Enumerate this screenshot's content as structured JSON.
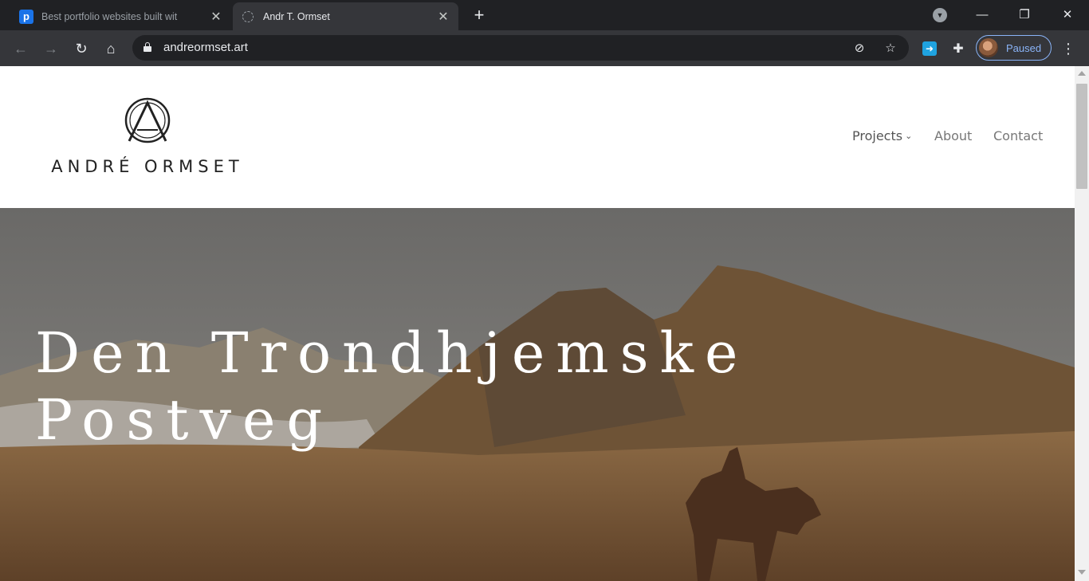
{
  "browser": {
    "tabs": [
      {
        "title": "Best portfolio websites built wit",
        "favicon": "p-icon",
        "active": false
      },
      {
        "title": "Andr T. Ormset",
        "favicon": "ao-logo-icon",
        "active": true
      }
    ],
    "new_tab_label": "+",
    "url": "andreormset.art",
    "profile_label": "Paused",
    "accent": "#8ab4f8"
  },
  "site": {
    "logo_text": "ANDRÉ ORMSET",
    "nav": {
      "projects": "Projects",
      "about": "About",
      "contact": "Contact"
    },
    "hero_title": "Den Trondhjemske Postveg"
  }
}
